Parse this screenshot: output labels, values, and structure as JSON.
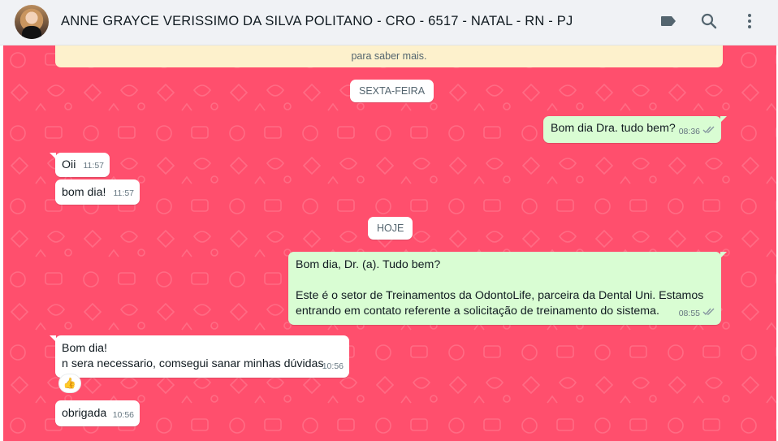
{
  "header": {
    "contact_name": "ANNE GRAYCE VERISSIMO DA SILVA POLITANO - CRO - 6517 - NATAL - RN - PJ",
    "icons": [
      "label-icon",
      "search-icon",
      "menu-icon"
    ]
  },
  "system_notice": {
    "text": "para saber mais."
  },
  "dates": {
    "friday": "SEXTA-FEIRA",
    "today": "HOJE"
  },
  "messages": {
    "m1": {
      "direction": "outgoing",
      "text": "Bom dia Dra. tudo bem?",
      "time": "08:36",
      "status": "read"
    },
    "m2": {
      "direction": "incoming",
      "text": "Oii",
      "time": "11:57"
    },
    "m3": {
      "direction": "incoming",
      "text": "bom dia!",
      "time": "11:57"
    },
    "m4": {
      "direction": "outgoing",
      "text": "Bom dia, Dr. (a). Tudo bem?\n\nEste é o setor de Treinamentos da OdontoLife, parceira da Dental Uni. Estamos entrando em contato referente a solicitação de treinamento do sistema.",
      "time": "08:55",
      "status": "read"
    },
    "m5": {
      "direction": "incoming",
      "text": "Bom dia!\nn sera necessario, comsegui sanar minhas dúvidas",
      "time": "10:56",
      "reaction": "👍"
    },
    "m6": {
      "direction": "incoming",
      "text": "obrigada",
      "time": "10:56"
    }
  },
  "colors": {
    "chat_background": "#ff4f6d",
    "outgoing_bubble": "#d9fdd3",
    "incoming_bubble": "#ffffff",
    "header_background": "#f0f2f5",
    "read_tick": "#8696a0"
  }
}
